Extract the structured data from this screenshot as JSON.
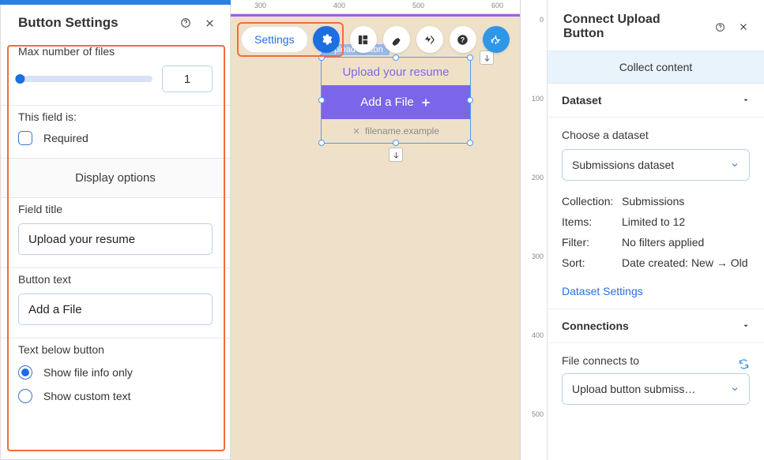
{
  "left_panel": {
    "title": "Button Settings",
    "max_files_label": "Max number of files",
    "max_files_value": "1",
    "this_field_is": "This field is:",
    "required_label": "Required",
    "display_options": "Display options",
    "field_title_label": "Field title",
    "field_title_value": "Upload your resume",
    "button_text_label": "Button text",
    "button_text_value": "Add a File",
    "text_below_label": "Text below button",
    "radio_option_a": "Show file info only",
    "radio_option_b": "Show custom text"
  },
  "toolbar": {
    "settings_label": "Settings"
  },
  "ruler": {
    "t300": "300",
    "t400": "400",
    "t500": "500",
    "t600": "600",
    "v0": "0",
    "v100": "100",
    "v200": "200",
    "v300": "300",
    "v400": "400",
    "v500": "500"
  },
  "widget": {
    "tag": "Upload Button",
    "title": "Upload your resume",
    "button": "Add a File",
    "filename": "filename.example"
  },
  "right_panel": {
    "title": "Connect Upload Button",
    "tab": "Collect content",
    "dataset_header": "Dataset",
    "choose_dataset": "Choose a dataset",
    "dataset_value": "Submissions dataset",
    "kv": {
      "collection_k": "Collection:",
      "collection_v": "Submissions",
      "items_k": "Items:",
      "items_v": "Limited to 12",
      "filter_k": "Filter:",
      "filter_v": "No filters applied",
      "sort_k": "Sort:",
      "sort_v": "Date created: New → Old"
    },
    "dataset_settings": "Dataset Settings",
    "connections_header": "Connections",
    "file_connects": "File connects to",
    "file_connects_value": "Upload button submiss…"
  }
}
